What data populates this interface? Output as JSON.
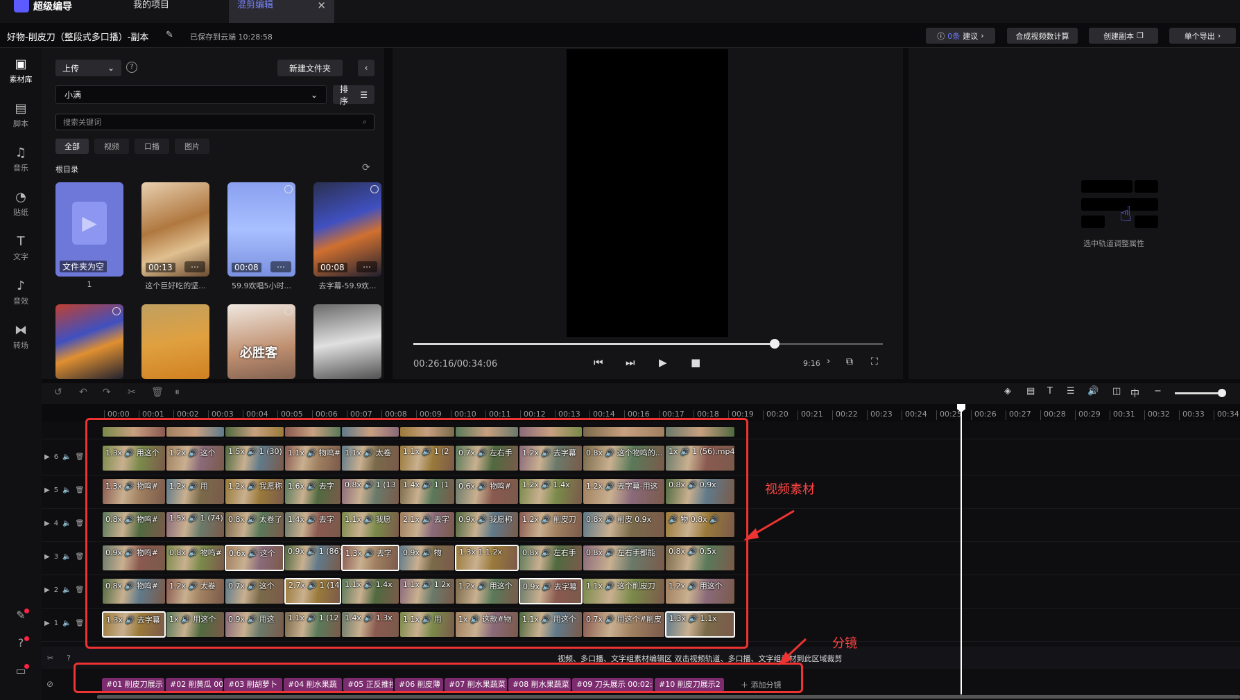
{
  "app": {
    "name": "超级编导",
    "tabs": [
      {
        "label": "我的项目"
      },
      {
        "label": "混剪编辑"
      }
    ]
  },
  "titlebar": {
    "project": "好物-削皮刀（整段式多口播）-副本",
    "saved": "已保存到云端 10:28:58",
    "suggest": {
      "count": "0条",
      "label": "建议"
    },
    "calc": "合成视频数计算",
    "copy": "创建副本",
    "export": "单个导出"
  },
  "nav": [
    {
      "label": "素材库",
      "icon": "media-library-icon"
    },
    {
      "label": "脚本",
      "icon": "script-icon"
    },
    {
      "label": "音乐",
      "icon": "music-icon"
    },
    {
      "label": "贴纸",
      "icon": "sticker-icon"
    },
    {
      "label": "文字",
      "icon": "text-icon"
    },
    {
      "label": "音效",
      "icon": "sound-effect-icon"
    },
    {
      "label": "转场",
      "icon": "transition-icon"
    }
  ],
  "library": {
    "upload": "上传",
    "new_folder": "新建文件夹",
    "folder": "小满",
    "sort": "排序",
    "search_placeholder": "搜索关键词",
    "filters": [
      "全部",
      "视频",
      "口播",
      "图片"
    ],
    "root": "根目录",
    "items": [
      {
        "caption": "1",
        "badge": "文件夹为空"
      },
      {
        "caption": "这个巨好吃的坚...",
        "duration": "00:13"
      },
      {
        "caption": "59.9欢唱5小时...",
        "duration": "00:08"
      },
      {
        "caption": "去字幕-59.9欢...",
        "duration": "00:08"
      },
      {
        "caption": ""
      },
      {
        "caption": ""
      },
      {
        "caption": "",
        "overlay": "必胜客"
      },
      {
        "caption": ""
      }
    ]
  },
  "preview": {
    "time": "00:26:16/00:34:06",
    "ratio": "9:16",
    "progress": 0.77
  },
  "props": {
    "hint": "选中轨道调整属性"
  },
  "ruler": [
    "00:00",
    "00:01",
    "00:02",
    "00:03",
    "00:04",
    "00:05",
    "00:06",
    "00:07",
    "00:08",
    "00:09",
    "00:10",
    "00:11",
    "00:12",
    "00:13",
    "00:14",
    "00:16",
    "00:17",
    "00:18",
    "00:19",
    "00:20",
    "00:21",
    "00:22",
    "00:23",
    "00:24",
    "00:25",
    "00:26",
    "00:27",
    "00:28",
    "00:29",
    "00:31",
    "00:32",
    "00:33",
    "00:34"
  ],
  "tracks": [
    {
      "num": "6",
      "clips": [
        "1.3x 🔊 用这个",
        "1.2x 🔊 这个",
        "1.5x 🔊 1 (30)",
        "1.1x 🔊 物鸣#",
        "1.1x 🔊 太卷",
        "1.1x 🔊 1 (2",
        "0.7x 🔊 左右手",
        "1.2x 🔊 去字幕",
        "0.8x 🔊 这个物鸣的...",
        "1x 🔊 1 (56).mp4"
      ]
    },
    {
      "num": "5",
      "clips": [
        "1.3x 🔊 物鸣#",
        "1.2x 🔊 用",
        "1.2x 🔊 我愿称",
        "1.6x 🔊 去字",
        "0.8x 🔊 1 (13",
        "1.4x 🔊 1 (1",
        "0.6x 🔊 物鸣#",
        "1.2x 🔊 1.4x",
        "1.2x 🔊 去字幕-用这",
        "0.8x 🔊 0.9x"
      ]
    },
    {
      "num": "4",
      "clips": [
        "0.8x 🔊 物鸣#",
        "1.5x 🔊 1 (74)",
        "0.8x 🔊 太卷了",
        "1.4x 🔊 去字",
        "1.1x 🔊 我愿",
        "2.1x 🔊 去字",
        "0.9x 🔊 我愿称",
        "1.2x 🔊 削皮刀",
        "0.8x 🔊 削皮 0.9x",
        "🔊 物 0.8x 🔊"
      ]
    },
    {
      "num": "3",
      "clips": [
        "0.9x 🔊 物鸣#",
        "0.8x 🔊 物鸣#",
        "0.6x 🔊 这个",
        "0.9x 🔊 1 (86)",
        "1.3x 🔊 去字",
        "0.9x 🔊 物",
        "1.3x 1 1.2x",
        "0.8x 🔊 左右手",
        "0.8x 🔊 左右手都能",
        "0.8x 🔊 0.5x"
      ]
    },
    {
      "num": "2",
      "clips": [
        "0.8x 🔊 物鸣#",
        "1.2x 🔊 太卷",
        "0.7x 🔊 这个",
        "2.7x 🔊 1 (14",
        "1.1x 🔊 1.4x",
        "1.1x 🔊 1.2x",
        "1.2x 🔊 用这个",
        "0.9x 🔊 去字幕",
        "1.1x 🔊 这个削皮刀",
        "1.2x 🔊 用这个"
      ]
    },
    {
      "num": "1",
      "clips": [
        "1.3x 🔊 去字幕",
        "1x 🔊 用这个",
        "0.9x 🔊 用这",
        "1.1x 🔊 1 (12",
        "1.4x 🔊 1.3x",
        "1.1x 🔊 用",
        "1x 🔊 这款#物",
        "1.1x 🔊 用这个",
        "0.7x 🔊 用这个#削皮",
        "1.3x 🔊 1.1x"
      ]
    }
  ],
  "hints": "视频、多口播、文字组素材编辑区  双击视频轨道、多口播、文字组素材到此区域裁剪",
  "shots": [
    "#01 削皮刀展示",
    "#02 削黄瓜 00",
    "#03 削胡萝卜",
    "#04 削水果蔬",
    "#05 正反推拉",
    "#06 削皮薄",
    "#07 削水果蔬菜",
    "#08 削水果蔬菜",
    "#09 刀头展示 00:02:1",
    "#10 削皮刀展示2"
  ],
  "add_shot": "添加分镜",
  "annotations": {
    "video": "视频素材",
    "shots": "分镜"
  },
  "colors": {
    "accent": "#6a7bff",
    "shot": "#7c2c6e",
    "annotation": "#e33"
  }
}
